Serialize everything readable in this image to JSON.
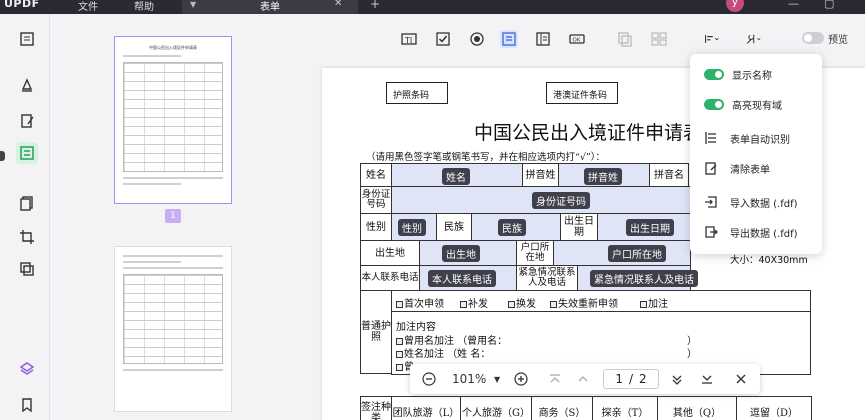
{
  "app": {
    "logo": "UPDF",
    "menu": [
      "文件",
      "帮助"
    ],
    "tab_title": "表单",
    "avatar_letter": "y"
  },
  "toolbar": {
    "preview_label": "预览"
  },
  "thumbnails": {
    "page1_title": "中国公民出入境证件申请表",
    "selected_page_badge": "1"
  },
  "document": {
    "passport_barcode": "护照条码",
    "hk_barcode": "港澳证件条码",
    "title": "中国公民出入境证件申请表",
    "instruction": "（请用黑色签字笔或钢笔书写，并在相应选项内打“√”）：",
    "labels": {
      "name": "姓名",
      "pinyin_surname": "拼音姓",
      "pinyin_given": "拼音名",
      "id_number": "身份证号码",
      "gender": "性别",
      "ethnicity": "民族",
      "birth_date": "出生日期",
      "birthplace": "出生地",
      "hukou": "户口所在地",
      "personal_contact": "本人联系电话",
      "emergency_contact": "紧急情况联系人及电话",
      "ordinary_passport": "普通护照",
      "visa_type": "签注种类"
    },
    "fields": {
      "name": "姓名",
      "pinyin_surname": "拼音姓",
      "id_number": "身份证号码",
      "gender": "性别",
      "ethnicity": "民族",
      "birth_date": "出生日期",
      "birthplace": "出生地",
      "hukou": "户口所在地",
      "personal_phone": "本人联系电话",
      "emergency_contact": "紧急情况联系人及电话"
    },
    "passport_options": [
      "首次申领",
      "补发",
      "换发",
      "失效重新申领",
      "加注"
    ],
    "endorsement_title": "加注内容",
    "endorsement_lines": [
      "曾用名加注 （曾用名：",
      "姓名加注 （姓 名：",
      "曾"
    ],
    "endorsement_close": "）",
    "visa_types": [
      "团队旅游（L）",
      "个人旅游（G）",
      "商务（S）",
      "探亲（T）",
      "其他（Q）",
      "逗留（D）"
    ],
    "photo_size": "大小：40X30mm"
  },
  "dropdown": {
    "items": [
      {
        "label": "显示名称",
        "type": "toggle",
        "on": true
      },
      {
        "label": "高亮现有域",
        "type": "toggle",
        "on": true
      },
      {
        "label": "表单自动识别",
        "type": "icon",
        "icon": "auto-recognize-icon"
      },
      {
        "label": "清除表单",
        "type": "icon",
        "icon": "clear-form-icon"
      },
      {
        "label": "导入数据 (.fdf)",
        "type": "icon",
        "icon": "import-icon"
      },
      {
        "label": "导出数据 (.fdf)",
        "type": "icon",
        "icon": "export-icon"
      }
    ]
  },
  "zoom": {
    "level": "101%",
    "current_page": "1",
    "separator": "/",
    "total_pages": "2"
  },
  "colors": {
    "field_highlight": "#dfe5f7",
    "toggle_on": "#2fb36c",
    "active_tool": "#d7e3ff",
    "selected_thumb": "#b18cf0"
  }
}
